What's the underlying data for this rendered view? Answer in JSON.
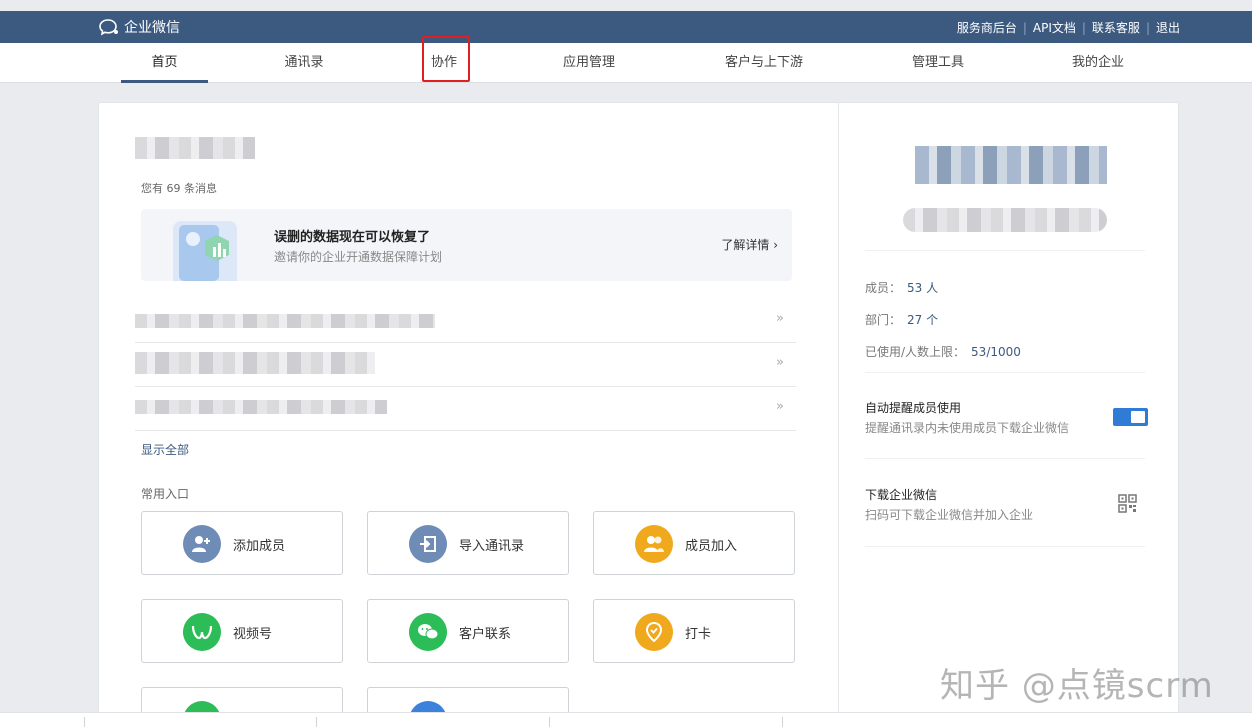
{
  "header": {
    "brand": "企业微信",
    "links": [
      "服务商后台",
      "API文档",
      "联系客服",
      "退出"
    ]
  },
  "nav": {
    "items": [
      "首页",
      "通讯录",
      "协作",
      "应用管理",
      "客户与上下游",
      "管理工具",
      "我的企业"
    ],
    "active": "首页",
    "highlighted": "协作"
  },
  "main": {
    "message_count": "您有 69 条消息",
    "banner": {
      "title": "误删的数据现在可以恢复了",
      "subtitle": "邀请你的企业开通数据保障计划",
      "link": "了解详情 ›"
    },
    "row_arrow": "»",
    "show_all": "显示全部",
    "common_title": "常用入口",
    "tiles": [
      {
        "label": "添加成员",
        "icon": "add-user-icon",
        "color": "#6f8cb6"
      },
      {
        "label": "导入通讯录",
        "icon": "import-icon",
        "color": "#6f8cb6"
      },
      {
        "label": "成员加入",
        "icon": "members-icon",
        "color": "#f0a81c"
      },
      {
        "label": "视频号",
        "icon": "video-channel-icon",
        "color": "#2dbd58"
      },
      {
        "label": "客户联系",
        "icon": "wechat-icon",
        "color": "#2dbd58"
      },
      {
        "label": "打卡",
        "icon": "location-pin-icon",
        "color": "#f0a81c"
      }
    ]
  },
  "side": {
    "stats": [
      {
        "label": "成员：",
        "value": "53 人"
      },
      {
        "label": "部门：",
        "value": "27 个"
      },
      {
        "label": "已使用/人数上限：",
        "value": "53/1000"
      }
    ],
    "auto_remind": {
      "title": "自动提醒成员使用",
      "subtitle": "提醒通讯录内未使用成员下载企业微信",
      "enabled": true
    },
    "download": {
      "title": "下载企业微信",
      "subtitle": "扫码可下载企业微信并加入企业"
    }
  },
  "watermark": "知乎 @点镜scrm"
}
